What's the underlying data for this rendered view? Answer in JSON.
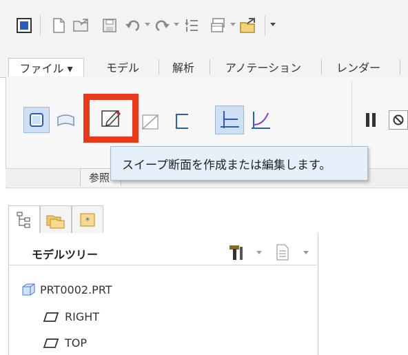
{
  "quick_access_toolbar": {
    "icons": [
      "app-icon",
      "new-file-icon",
      "open-file-icon",
      "save-icon",
      "undo-icon",
      "redo-icon",
      "regenerate-icon",
      "windows-icon",
      "close-window-icon",
      "customize-icon"
    ]
  },
  "tabs": [
    {
      "label": "ファイル ▾"
    },
    {
      "label": "モデル"
    },
    {
      "label": "解析"
    },
    {
      "label": "アノテーション"
    },
    {
      "label": "レンダー"
    }
  ],
  "ribbon": {
    "group_label_partial": "参照"
  },
  "tooltip": {
    "text": "スイープ断面を作成または編集します。"
  },
  "model_tree": {
    "title": "モデルツリー",
    "items": [
      {
        "label": "PRT0002.PRT",
        "icon": "part-icon"
      },
      {
        "label": "RIGHT",
        "icon": "datum-plane-icon"
      },
      {
        "label": "TOP",
        "icon": "datum-plane-icon"
      }
    ]
  },
  "colors": {
    "highlight": "#e8391b",
    "tooltip_bg": "#e6f0fa",
    "accent": "#2a5bbf"
  }
}
